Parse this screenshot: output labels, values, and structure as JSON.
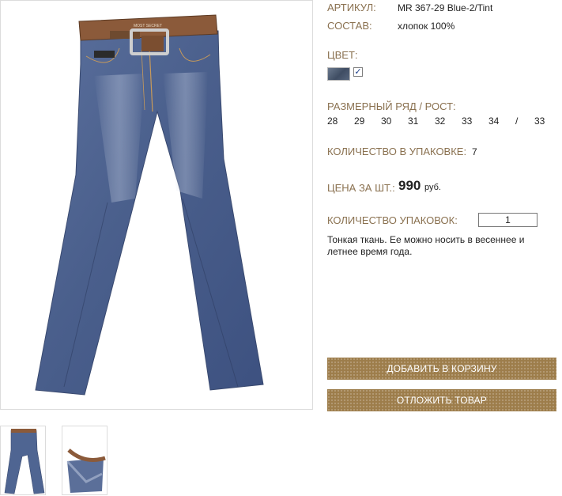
{
  "product": {
    "article_label": "АРТИКУЛ:",
    "article_value": "MR 367-29 Blue-2/Tint",
    "composition_label": "СОСТАВ:",
    "composition_value": "хлопок 100%",
    "color_label": "ЦВЕТ:",
    "color_swatch": "#4d5b72",
    "color_checked_mark": "✓",
    "size_label": "РАЗМЕРНЫЙ РЯД / РОСТ:",
    "sizes": [
      "28",
      "29",
      "30",
      "31",
      "32",
      "33",
      "34",
      "/",
      "33"
    ],
    "pack_qty_label": "КОЛИЧЕСТВО В УПАКОВКЕ:",
    "pack_qty_value": "7",
    "price_label": "ЦЕНА ЗА ШТ.:",
    "price_value": "990",
    "price_currency": "руб.",
    "packs_label": "КОЛИЧЕСТВО УПАКОВОК:",
    "packs_input_value": "1",
    "description": "Тонкая ткань. Ее можно носить в весеннее и летнее время года."
  },
  "buttons": {
    "add_to_cart": "ДОБАВИТЬ В КОРЗИНУ",
    "postpone": "ОТЛОЖИТЬ ТОВАР"
  },
  "images": {
    "main_photo": "jeans-front-with-belt",
    "thumbnails": [
      "jeans-front-full",
      "jeans-waist-closeup"
    ]
  },
  "colors": {
    "label_color": "#8a7150",
    "button_color": "#9d7d4b",
    "denim_color": "#4f6592",
    "belt_color": "#8b5a3a"
  }
}
